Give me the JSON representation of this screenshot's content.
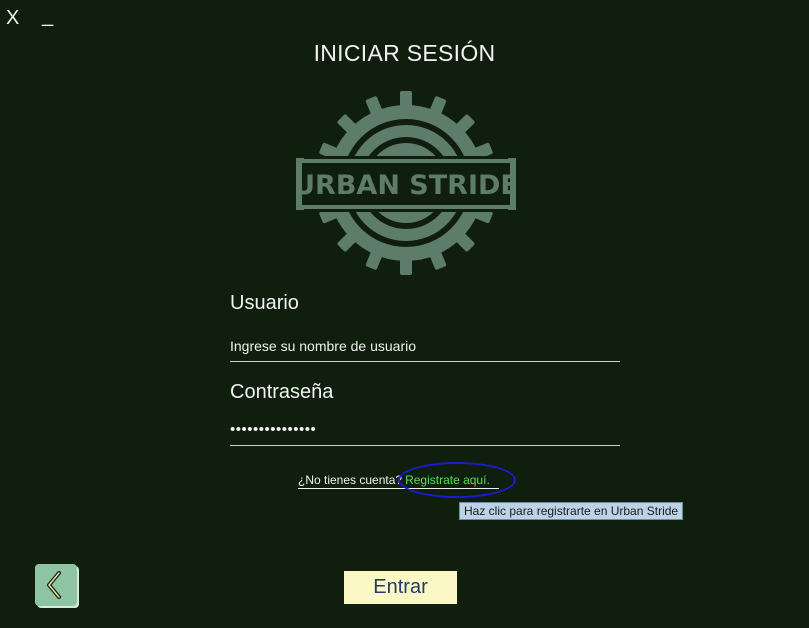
{
  "window": {
    "close_label": "X",
    "minimize_label": "_"
  },
  "header": {
    "title": "INICIAR SESIÓN"
  },
  "logo": {
    "text": "URBAN STRIDE",
    "color": "#5d7d6a"
  },
  "form": {
    "user_label": "Usuario",
    "user_value": "Ingrese su nombre de usuario",
    "password_label": "Contraseña",
    "password_value": "•••••••••••••••"
  },
  "register": {
    "prompt": "¿No tienes cuenta?",
    "link": "Registrate aquí.",
    "tooltip": "Haz clic para registrarte en Urban Stride"
  },
  "actions": {
    "back_icon": "chevron-left-icon",
    "enter_label": "Entrar"
  },
  "colors": {
    "background": "#0f1e0d",
    "link": "#56e04f",
    "enter_button": "#fbf8c5",
    "back_button": "#8ec3a3"
  }
}
